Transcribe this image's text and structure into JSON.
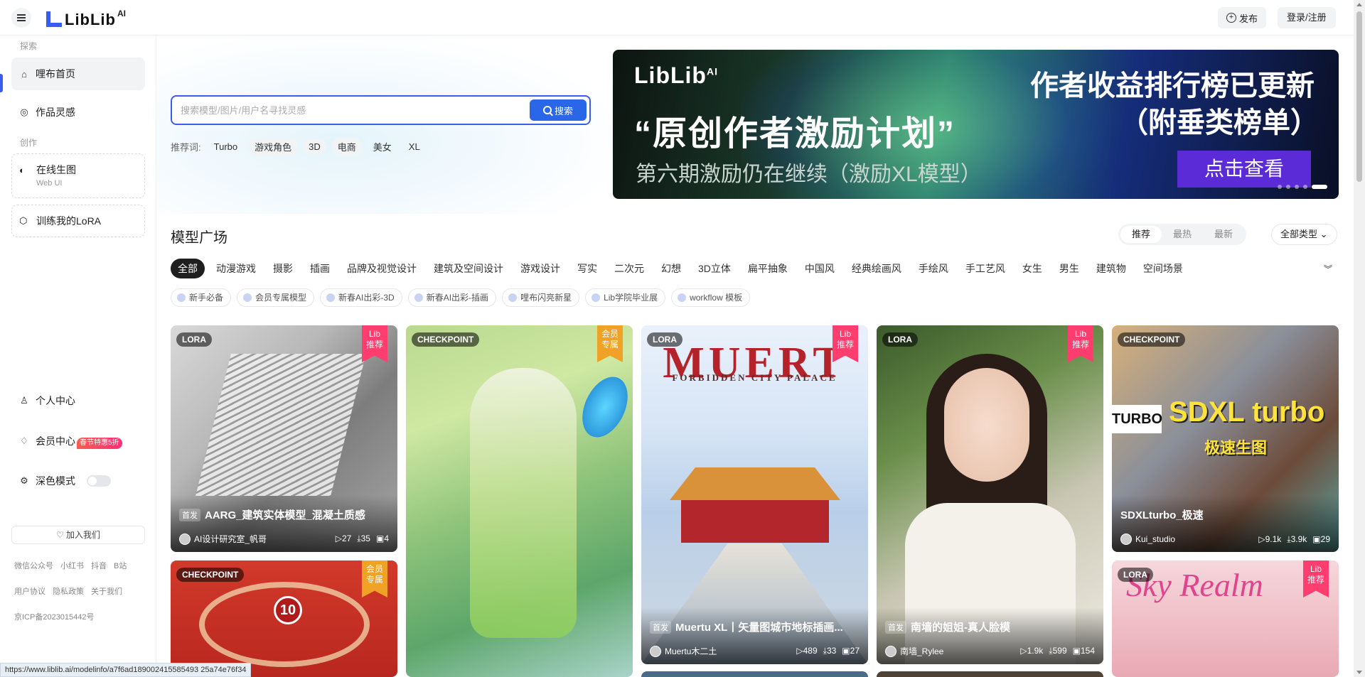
{
  "app": {
    "logo_text": "LibLib",
    "logo_ai": "AI",
    "publish_label": "发布",
    "login_label": "登录/注册"
  },
  "sidebar": {
    "explore_label": "探索",
    "home_label": "哩布首页",
    "inspiration_label": "作品灵感",
    "create_label": "创作",
    "online_gen_label": "在线生图",
    "online_gen_sub": "Web UI",
    "train_label": "训练我的LoRA",
    "profile_label": "个人中心",
    "vip_label": "会员中心",
    "vip_badge": "春节特惠5折",
    "dark_label": "深色模式",
    "join_label": "加入我们",
    "links_row1": [
      "微信公众号",
      "小红书",
      "抖音",
      "B站"
    ],
    "links_row2": [
      "用户协议",
      "隐私政策",
      "关于我们"
    ],
    "icp": "京ICP备2023015442号"
  },
  "search": {
    "placeholder": "搜索模型/图片/用户名寻找灵感",
    "button_label": "搜索",
    "rec_label": "推荐词:",
    "rec_tags": [
      "Turbo",
      "游戏角色",
      "3D",
      "电商",
      "美女",
      "XL"
    ]
  },
  "banner": {
    "logo": "LibLib",
    "logo_ai": "AI",
    "main": "“原创作者激励计划”",
    "sub": "第六期激励仍在继续（激励XL模型）",
    "right1": "作者收益排行榜已更新",
    "right2": "（附垂类榜单）",
    "cta": "点击查看"
  },
  "plaza": {
    "title": "模型广场",
    "sort_options": [
      "推荐",
      "最热",
      "最新"
    ],
    "type_select": "全部类型",
    "categories": [
      "全部",
      "动漫游戏",
      "摄影",
      "插画",
      "品牌及视觉设计",
      "建筑及空间设计",
      "游戏设计",
      "写实",
      "二次元",
      "幻想",
      "3D立体",
      "扁平抽象",
      "中国风",
      "经典绘画风",
      "手绘风",
      "手工艺风",
      "女生",
      "男生",
      "建筑物",
      "空间场景"
    ],
    "tags": [
      "新手必备",
      "会员专属模型",
      "新春AI出彩-3D",
      "新春AI出彩-插画",
      "哩布闪亮新星",
      "Lib学院毕业展",
      "workflow 模板"
    ]
  },
  "cards": [
    {
      "type": "LORA",
      "ribbon": "Lib\n推荐",
      "first": "首发",
      "title": "AARG_建筑实体模型_混凝土质感",
      "author": "AI设计研究室_帆哥",
      "stats": [
        "27",
        "35",
        "4"
      ]
    },
    {
      "type": "CHECKPOINT",
      "ribbon": "会员\n专属"
    },
    {
      "type": "LORA",
      "ribbon": "Lib\n推荐",
      "first": "首发",
      "title": "Muertu XL丨矢量图城市地标插画...",
      "author": "Muertu木二土",
      "stats": [
        "489",
        "33",
        "27"
      ],
      "art_title": "MUERT",
      "art_sub": "FORBIDDEN CITY PALACE"
    },
    {
      "type": "LORA",
      "ribbon": "Lib\n推荐",
      "first": "首发",
      "title": "南墙的姐姐-真人脸模",
      "author": "南墙_Rylee",
      "stats": [
        "1.9k",
        "599",
        "154"
      ]
    },
    {
      "type": "CHECKPOINT",
      "title": "SDXLturbo_极速",
      "author": "Kui_studio",
      "stats": [
        "9.1k",
        "3.9k",
        "29"
      ],
      "art_title": "SDXL turbo",
      "art_turbo": "TURBO",
      "art_sub": "极速生图"
    },
    {
      "type": "CHECKPOINT",
      "ribbon": "会员\n专属",
      "art_num": "10"
    },
    {
      "type": "LORA",
      "ribbon": "Lib\n推荐",
      "art_title": "Sky Realm"
    }
  ],
  "status_url": "https://www.liblib.ai/modelinfo/a7f6ad189002415585493 25a74e76f34"
}
